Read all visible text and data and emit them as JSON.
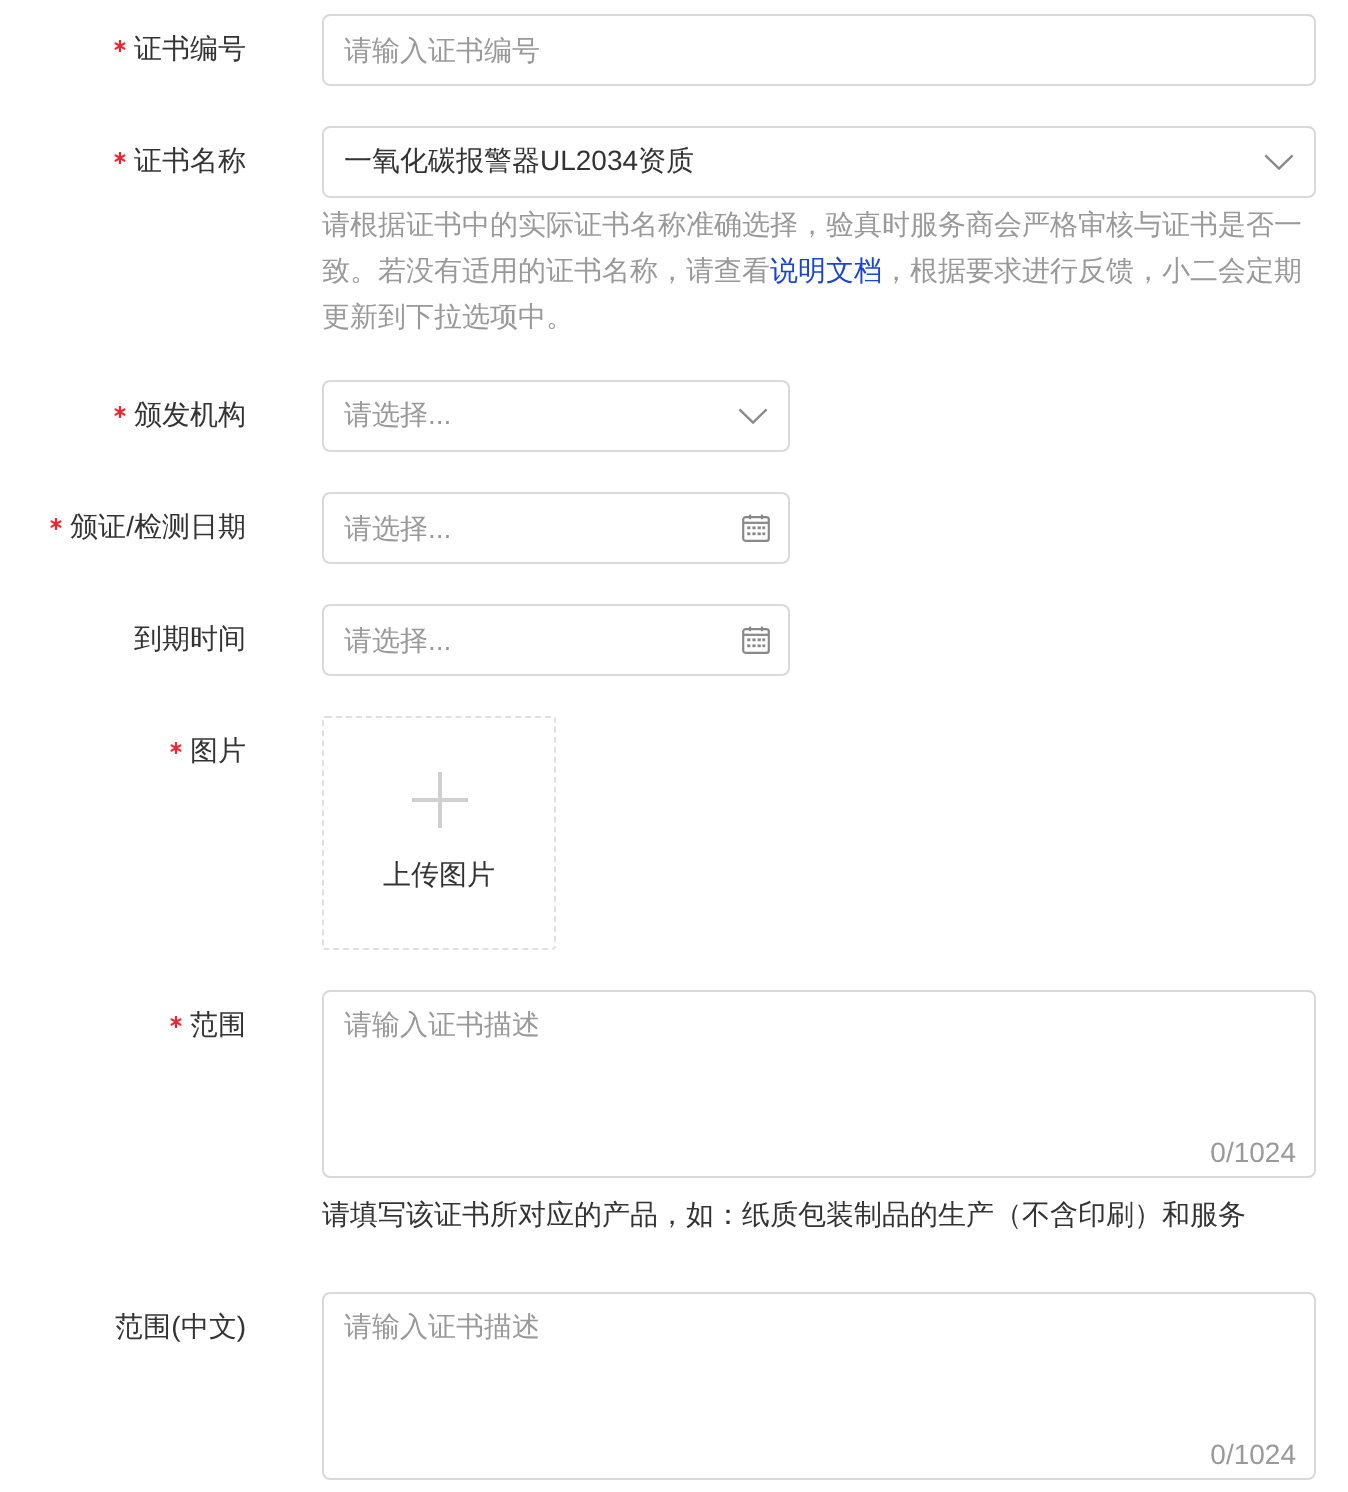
{
  "form": {
    "fields": [
      {
        "kind": "text",
        "label": "证书编号",
        "required": true,
        "placeholder": "请输入证书编号"
      },
      {
        "kind": "select",
        "label": "证书名称",
        "required": true,
        "value": "一氧化碳报警器UL2034资质",
        "help": {
          "text": "请根据证书中的实际证书名称准确选择，验真时服务商会严格审核与证书是否一致。若没有适用的证书名称，请查看",
          "link": "说明文档",
          "after": "，根据要求进行反馈，小二会定期更新到下拉选项中。"
        }
      },
      {
        "kind": "select",
        "label": "颁发机构",
        "required": true,
        "placeholder": "请选择..."
      },
      {
        "kind": "date",
        "label": "颁证/检测日期",
        "required": true,
        "placeholder": "请选择..."
      },
      {
        "kind": "date",
        "label": "到期时间",
        "required": false,
        "placeholder": "请选择..."
      },
      {
        "kind": "upload",
        "label": "图片",
        "required": true,
        "button": "上传图片"
      },
      {
        "kind": "textarea",
        "label": "范围",
        "required": true,
        "placeholder": "请输入证书描述",
        "counter": "0/1024",
        "help": {
          "text": "请填写该证书所对应的产品，如：纸质包装制品的生产（不含印刷）和服务"
        }
      },
      {
        "kind": "textarea",
        "label": "范围(中文)",
        "required": false,
        "placeholder": "请输入证书描述",
        "counter": "0/1024"
      }
    ]
  }
}
